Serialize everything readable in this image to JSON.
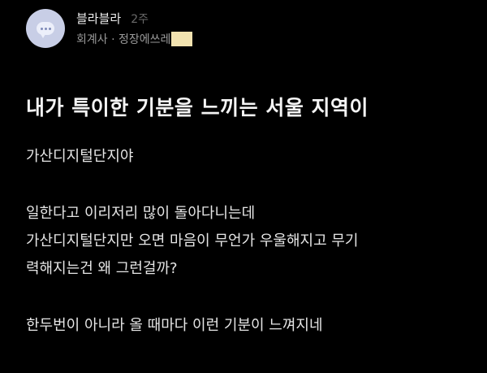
{
  "post": {
    "author": {
      "name": "블라블라",
      "time": "2주",
      "company": "회계사 · 정장에쓰레"
    },
    "title": "내가 특이한 기분을 느끼는 서울 지역이",
    "body": {
      "paragraph1": [
        "가산디지털단지야"
      ],
      "paragraph2": [
        "일한다고 이리저리 많이 돌아다니는데",
        "가산디지털단지만 오면 마음이 무언가 우울해지고 무기",
        "력해지는건 왜 그런걸까?"
      ],
      "paragraph3": [
        "한두번이 아니라 올 때마다 이런 기분이 느껴지네"
      ]
    }
  },
  "colors": {
    "background": "#000000",
    "avatar": "#c8cee6",
    "highlight": "#f2e3b0"
  },
  "icons": {
    "avatar": "chat-bubble-icon"
  }
}
